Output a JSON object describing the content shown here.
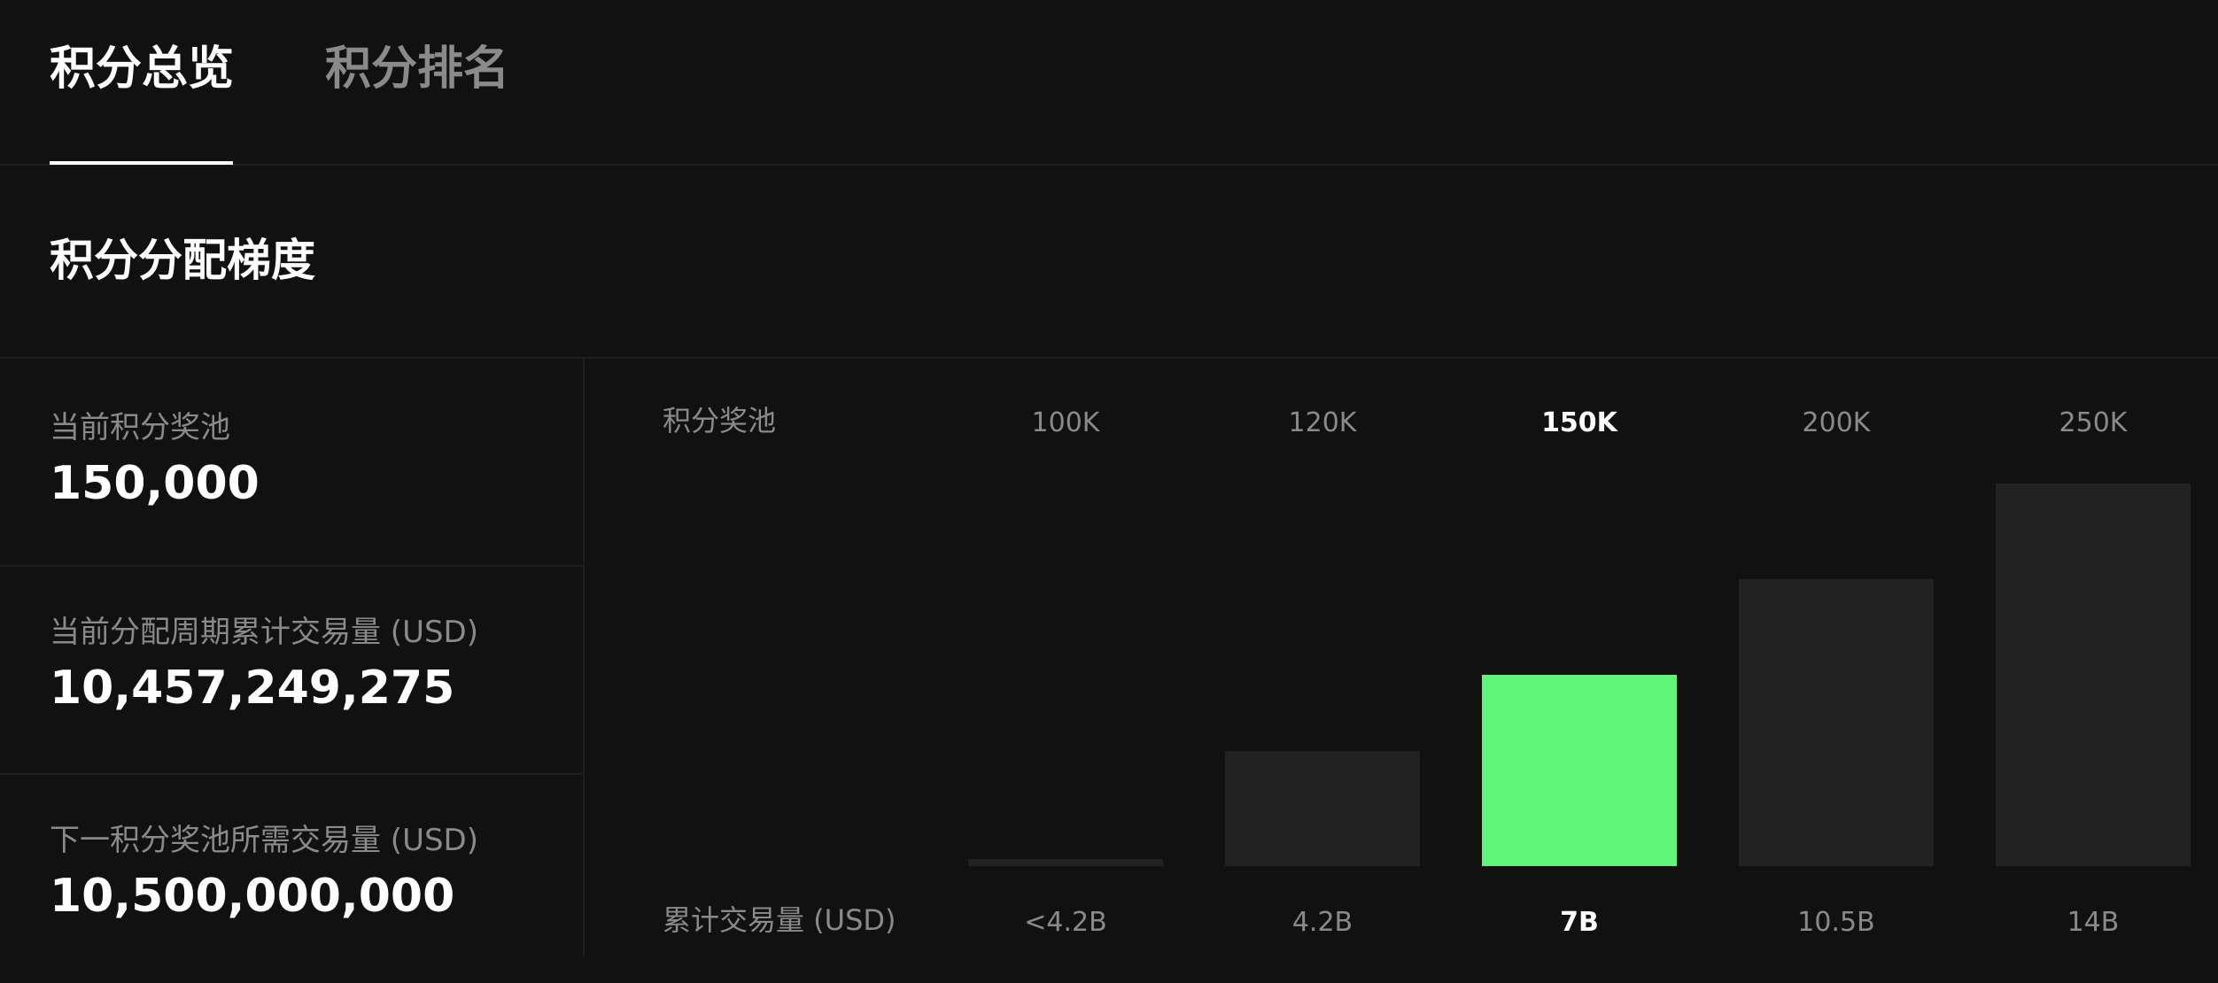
{
  "tabs": [
    {
      "label": "积分总览",
      "active": true
    },
    {
      "label": "积分排名",
      "active": false
    }
  ],
  "section": {
    "title": "积分分配梯度"
  },
  "stats": [
    {
      "label": "当前积分奖池",
      "value": "150,000"
    },
    {
      "label": "当前分配周期累计交易量 (USD)",
      "value": "10,457,249,275"
    },
    {
      "label": "下一积分奖池所需交易量 (USD)",
      "value": "10,500,000,000"
    }
  ],
  "colors": {
    "background": "#111111",
    "bar": "#222222",
    "highlight": "#60f47a",
    "muted_text": "#8a8a8a"
  },
  "chart_data": {
    "type": "bar",
    "top_row_label": "积分奖池",
    "bottom_row_label": "累计交易量 (USD)",
    "categories": [
      "100K",
      "120K",
      "150K",
      "200K",
      "250K"
    ],
    "values": [
      1,
      30,
      50,
      75,
      100
    ],
    "x_values": [
      "<4.2B",
      "4.2B",
      "7B",
      "10.5B",
      "14B"
    ],
    "highlight_index": 2
  }
}
